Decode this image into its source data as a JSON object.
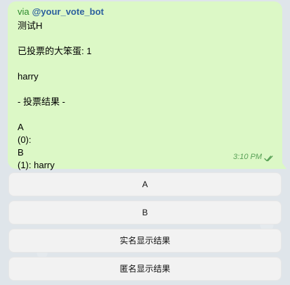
{
  "message": {
    "via_prefix": "via",
    "bot_name": "@your_vote_bot",
    "lines": [
      "测试H",
      "",
      "已投票的大笨蛋: 1",
      "",
      "harry",
      "",
      "- 投票结果 -",
      "",
      "A",
      "(0):",
      "B",
      "(1): harry"
    ],
    "time": "3:10 PM",
    "status_icon": "double-check-icon"
  },
  "buttons": [
    {
      "label": "A"
    },
    {
      "label": "B"
    },
    {
      "label": "实名显示结果"
    },
    {
      "label": "匿名显示结果"
    }
  ],
  "colors": {
    "bubble_bg": "#dcf8c6",
    "via_text": "#2d8c2d",
    "bot_name_text": "#2b5f9e",
    "meta_text": "#5aa257",
    "button_bg": "#f2f2f2"
  }
}
